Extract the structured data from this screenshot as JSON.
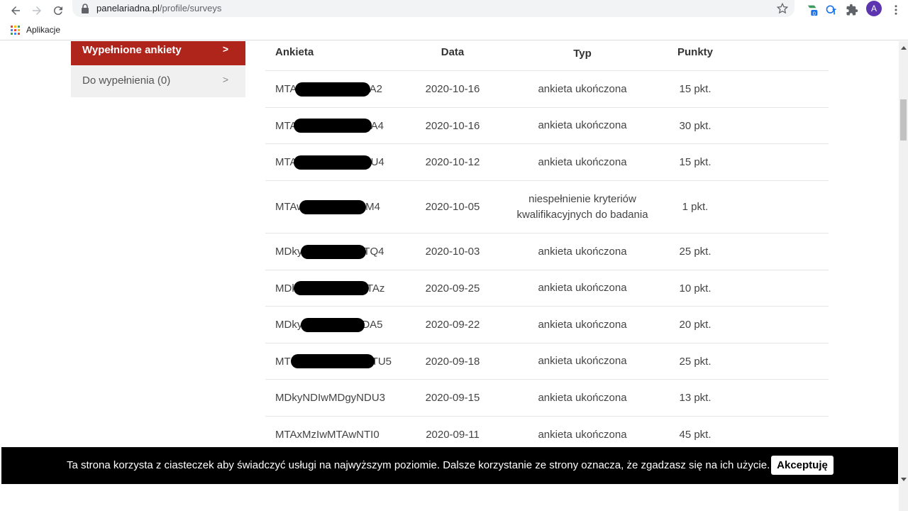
{
  "browser": {
    "url_host": "panelariadna.pl",
    "url_path": "/profile/surveys",
    "bookmarks_label": "Aplikacje",
    "profile_initial": "A",
    "extension_badge": "0"
  },
  "sidebar": {
    "active_label": "Wypełnione ankiety",
    "item_label": "Do wypełnienia (0)"
  },
  "table": {
    "headers": [
      "Ankieta",
      "Data",
      "Typ",
      "Punkty"
    ],
    "rows": [
      {
        "code_start": "MTA",
        "code_end": "A2",
        "date": "2020-10-16",
        "type": "ankieta ukończona",
        "points": "15 pkt."
      },
      {
        "code_start": "MTA",
        "code_end": "A4",
        "date": "2020-10-16",
        "type": "ankieta ukończona",
        "points": "30 pkt."
      },
      {
        "code_start": "MTA",
        "code_end": "U4",
        "date": "2020-10-12",
        "type": "ankieta ukończona",
        "points": "15 pkt."
      },
      {
        "code_start": "MTAw",
        "code_end": "M4",
        "date": "2020-10-05",
        "type_line1": "niespełnienie kryteriów",
        "type_line2": "kwalifikacyjnych do badania",
        "points": "1 pkt."
      },
      {
        "code_start": "MDky",
        "code_end": "TQ4",
        "date": "2020-10-03",
        "type": "ankieta ukończona",
        "points": "25 pkt."
      },
      {
        "code_start": "MDk",
        "code_end": "TAz",
        "date": "2020-09-25",
        "type": "ankieta ukończona",
        "points": "10 pkt."
      },
      {
        "code_start": "MDky",
        "code_end": "DA5",
        "date": "2020-09-22",
        "type": "ankieta ukończona",
        "points": "20 pkt."
      },
      {
        "code_start": "MT",
        "code_end": "TU5",
        "date": "2020-09-18",
        "type": "ankieta ukończona",
        "points": "25 pkt."
      },
      {
        "code": "MDkyNDIwMDgyNDU3",
        "date": "2020-09-15",
        "type": "ankieta ukończona",
        "points": "13 pkt."
      },
      {
        "code": "MTAxMzIwMTAwNTI0",
        "date": "2020-09-11",
        "type": "ankieta ukończona",
        "points": "45 pkt."
      }
    ]
  },
  "cookie": {
    "text": "Ta strona korzysta z ciasteczek aby świadczyć usługi na najwyższym poziomie. Dalsze korzystanie ze strony oznacza, że zgadzasz się na ich użycie.",
    "accept_label": "Akceptuję"
  },
  "colors": {
    "accent": "#b0251b",
    "cookie_bg": "#000000"
  }
}
